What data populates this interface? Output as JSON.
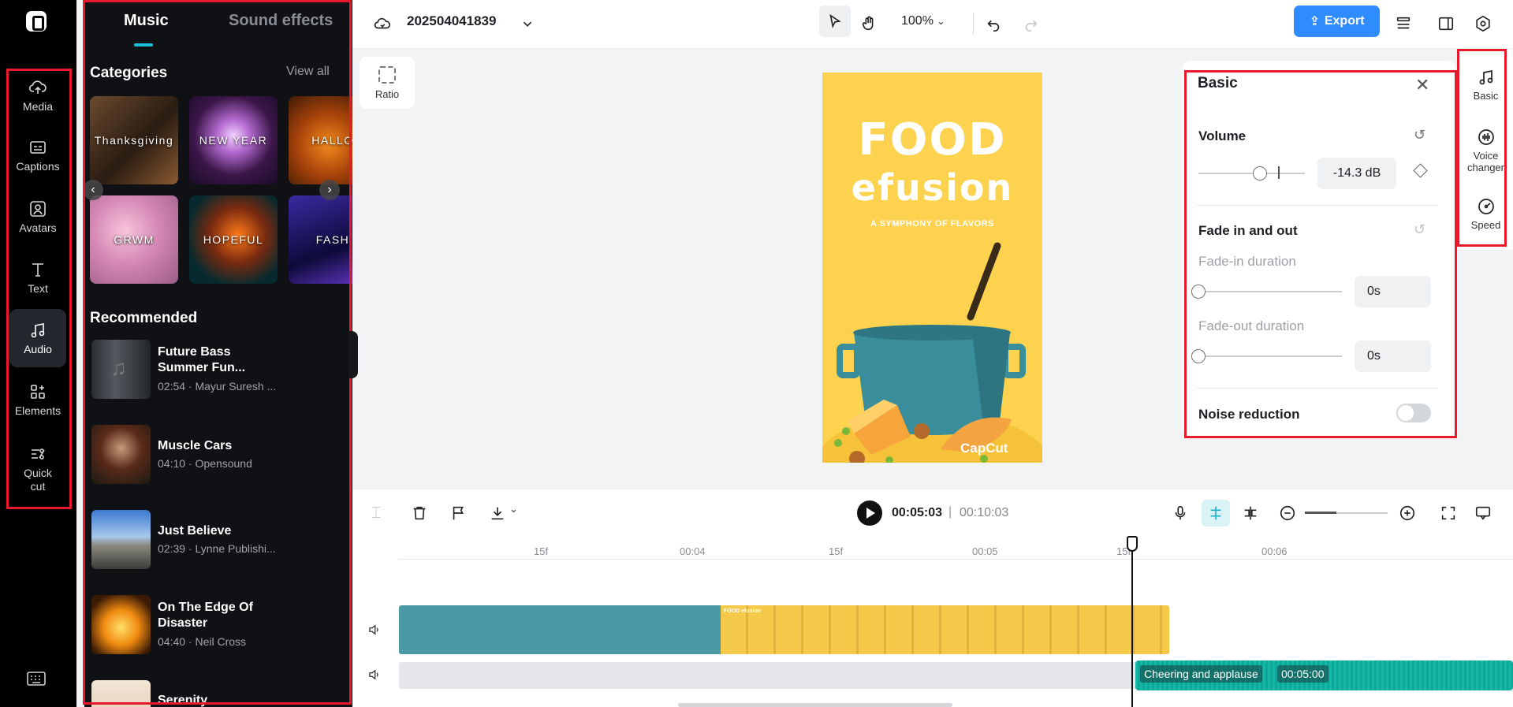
{
  "nav": {
    "items": [
      {
        "label": "Media",
        "icon": "cloud-upload-icon"
      },
      {
        "label": "Captions",
        "icon": "captions-icon"
      },
      {
        "label": "Avatars",
        "icon": "avatar-icon"
      },
      {
        "label": "Text",
        "icon": "text-icon"
      },
      {
        "label": "Audio",
        "icon": "music-note-icon"
      },
      {
        "label": "Elements",
        "icon": "elements-icon"
      },
      {
        "label": "Quick",
        "label2": "cut",
        "icon": "quick-cut-icon"
      }
    ],
    "active": "Audio"
  },
  "music_panel": {
    "tabs": [
      "Music",
      "Sound effects"
    ],
    "categories_title": "Categories",
    "view_all": "View all",
    "categories": [
      "Thanksgiving",
      "NEW YEAR",
      "HALLO",
      "GRWM",
      "HOPEFUL",
      "FASH"
    ],
    "recommended_title": "Recommended",
    "tracks": [
      {
        "title": "Future Bass Summer Fun...",
        "meta": "02:54 · Mayur Suresh ..."
      },
      {
        "title": "Muscle Cars",
        "meta": "04:10 · Opensound"
      },
      {
        "title": "Just Believe",
        "meta": "02:39 · Lynne Publishi..."
      },
      {
        "title": "On The Edge Of Disaster",
        "meta": "04:40 · Neil Cross"
      },
      {
        "title": "Serenity",
        "meta": ""
      }
    ]
  },
  "topbar": {
    "project_name": "202504041839",
    "zoom": "100%",
    "export_label": "Export"
  },
  "canvas": {
    "ratio_label": "Ratio",
    "preview_title_line1": "FOOD",
    "preview_title_line2": "efusion",
    "preview_subtitle": "A SYMPHONY OF FLAVORS",
    "preview_brand": "CapCut",
    "colors": {
      "poster_bg": "#fcd24e",
      "pot": "#3a8e9b"
    }
  },
  "basic_panel": {
    "title": "Basic",
    "volume_label": "Volume",
    "volume_value": "-14.3 dB",
    "volume_level": 0.58,
    "fade_title": "Fade in and out",
    "fade_in_label": "Fade-in duration",
    "fade_in_value": "0s",
    "fade_out_label": "Fade-out duration",
    "fade_out_value": "0s",
    "noise_label": "Noise reduction",
    "noise_enabled": false
  },
  "right_tabs": [
    {
      "label": "Basic",
      "icon": "music-note-icon"
    },
    {
      "label": "Voice changer",
      "icon": "voice-changer-icon"
    },
    {
      "label": "Speed",
      "icon": "speed-icon"
    }
  ],
  "timeline": {
    "current_time": "00:05:03",
    "separator": "|",
    "total_time": "00:10:03",
    "ruler": [
      "15f",
      "00:04",
      "15f",
      "00:05",
      "15f",
      "00:06"
    ],
    "audio_clip_name": "Cheering and applause",
    "audio_clip_duration": "00:05:00",
    "frame_label": "FOOD efusion"
  },
  "colors": {
    "accent": "#19c0d6",
    "export": "#2f8cff",
    "highlight": "#e8192c",
    "audio_clip": "#15b7a6"
  }
}
